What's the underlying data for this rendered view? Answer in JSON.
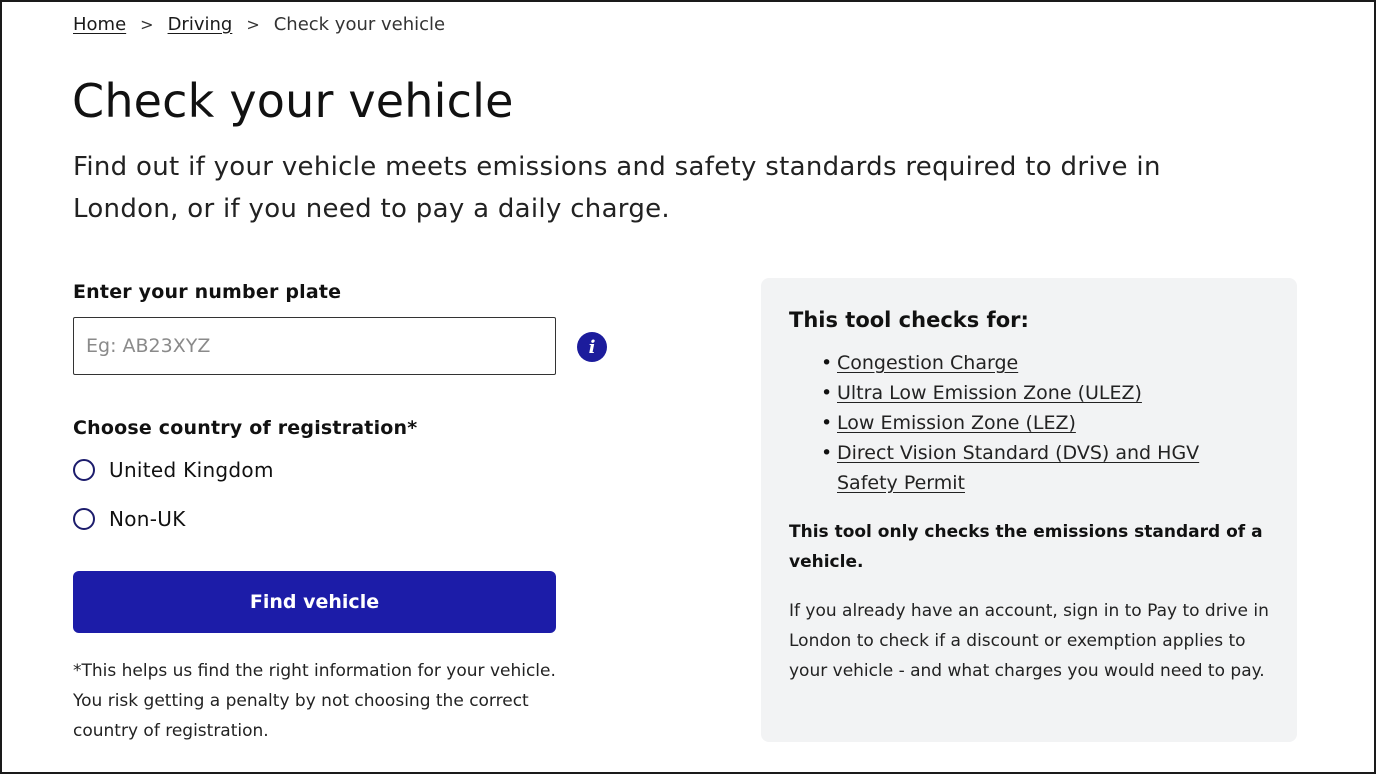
{
  "breadcrumb": {
    "items": [
      {
        "label": "Home"
      },
      {
        "label": "Driving"
      }
    ],
    "separator": ">",
    "current": "Check your vehicle"
  },
  "page": {
    "title": "Check your vehicle",
    "intro": "Find out if your vehicle meets emissions and safety standards required to drive in London, or if you need to pay a daily charge."
  },
  "form": {
    "plate_label": "Enter your number plate",
    "plate_placeholder": "Eg: AB23XYZ",
    "plate_value": "",
    "info_icon_glyph": "i",
    "country_label": "Choose country of registration*",
    "countries": [
      {
        "label": "United Kingdom",
        "selected": false
      },
      {
        "label": "Non-UK",
        "selected": false
      }
    ],
    "submit_label": "Find vehicle",
    "footnote": "*This helps us find the right information for your vehicle. You risk getting a penalty by not choosing the correct country of registration."
  },
  "panel": {
    "title": "This tool checks for:",
    "items": [
      {
        "label": "Congestion Charge"
      },
      {
        "label": "Ultra Low Emission Zone (ULEZ)"
      },
      {
        "label": "Low Emission Zone (LEZ)"
      },
      {
        "label": "Direct Vision Standard (DVS) and HGV Safety Permit"
      }
    ],
    "note_bold": "This tool only checks the emissions standard of a vehicle.",
    "note": "If you already have an account, sign in to Pay to drive in London to check if a discount or exemption applies to your vehicle - and what charges you would need to pay."
  },
  "colors": {
    "primary": "#1c1ca8",
    "info_icon": "#1c1c9c",
    "panel_bg": "#f2f3f4"
  }
}
